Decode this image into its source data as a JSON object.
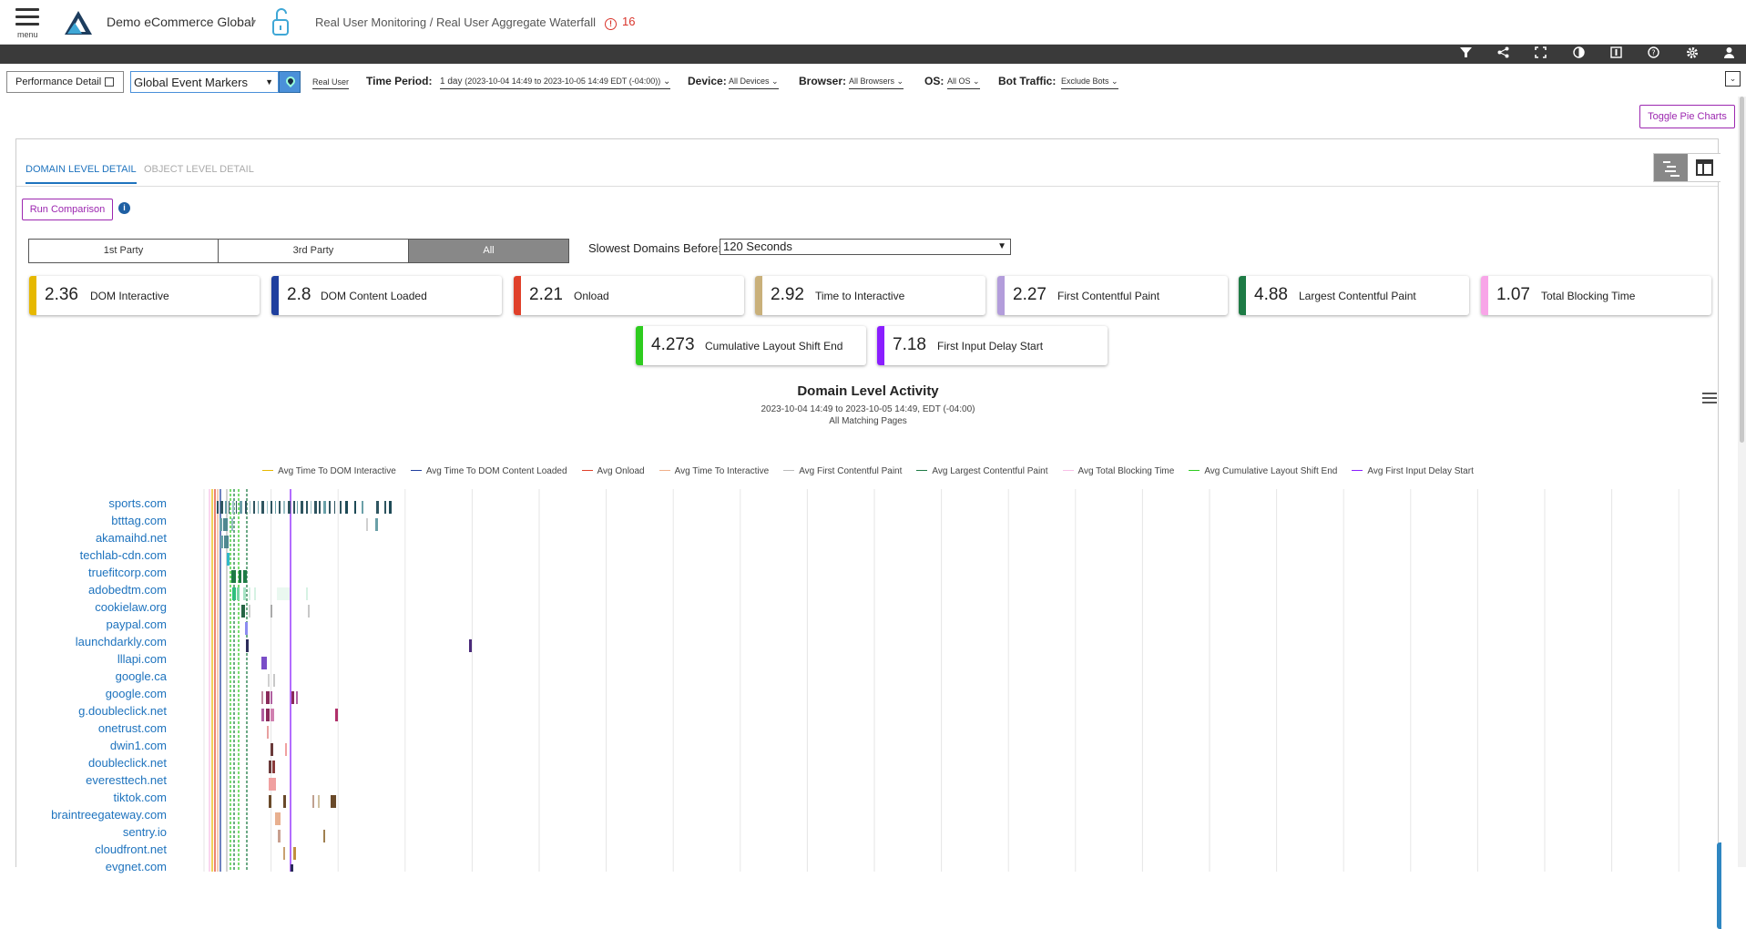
{
  "header": {
    "menu_label": "menu",
    "app_name": "Demo eCommerce Global",
    "breadcrumb": "Real User Monitoring / Real User Aggregate Waterfall",
    "alert_count": "16"
  },
  "toolbar_icons": [
    "filter-icon",
    "share-icon",
    "fullscreen-icon",
    "contrast-icon",
    "report-icon",
    "help-icon",
    "gear-icon",
    "user-icon"
  ],
  "filters": {
    "performance_detail": "Performance Detail",
    "event_markers": "Global Event Markers",
    "real_user": "Real User",
    "time_period_label": "Time Period:",
    "time_period_value": "1 day",
    "time_period_range": "(2023-10-04 14:49 to 2023-10-05 14:49 EDT (-04:00))",
    "device_label": "Device:",
    "device_value": "All Devices",
    "browser_label": "Browser:",
    "browser_value": "All Browsers",
    "os_label": "OS:",
    "os_value": "All OS",
    "bot_label": "Bot Traffic:",
    "bot_value": "Exclude Bots"
  },
  "toggle_pie": "Toggle Pie Charts",
  "tabs": [
    "DOMAIN LEVEL DETAIL",
    "OBJECT LEVEL DETAIL"
  ],
  "run_comparison": "Run Comparison",
  "party": [
    "1st Party",
    "3rd Party",
    "All"
  ],
  "slowest_label": "Slowest Domains Before:",
  "slowest_value": "120 Seconds",
  "metrics": [
    {
      "value": "2.36",
      "label": "DOM Interactive",
      "color": "#e6b800"
    },
    {
      "value": "2.8",
      "label": "DOM Content Loaded",
      "color": "#1f3f9e"
    },
    {
      "value": "2.21",
      "label": "Onload",
      "color": "#e0402a"
    },
    {
      "value": "2.92",
      "label": "Time to Interactive",
      "color": "#c9b07a"
    },
    {
      "value": "2.27",
      "label": "First Contentful Paint",
      "color": "#b39ddb"
    },
    {
      "value": "4.88",
      "label": "Largest Contentful Paint",
      "color": "#1e7b45"
    },
    {
      "value": "1.07",
      "label": "Total Blocking Time",
      "color": "#f8a5e8"
    },
    {
      "value": "4.273",
      "label": "Cumulative Layout Shift End",
      "color": "#2ecc1f"
    },
    {
      "value": "7.18",
      "label": "First Input Delay Start",
      "color": "#8a1eff"
    }
  ],
  "chart": {
    "title": "Domain Level Activity",
    "subtitle1": "2023-10-04 14:49 to 2023-10-05 14:49, EDT (-04:00)",
    "subtitle2": "All Matching Pages",
    "legend": [
      {
        "name": "Avg Time To DOM Interactive",
        "color": "#e6b800"
      },
      {
        "name": "Avg Time To DOM Content Loaded",
        "color": "#1f3f9e"
      },
      {
        "name": "Avg Onload",
        "color": "#e0402a"
      },
      {
        "name": "Avg Time To Interactive",
        "color": "#f0b08a"
      },
      {
        "name": "Avg First Contentful Paint",
        "color": "#bbbbbb"
      },
      {
        "name": "Avg Largest Contentful Paint",
        "color": "#1e7b45"
      },
      {
        "name": "Avg Total Blocking Time",
        "color": "#f8c0e8"
      },
      {
        "name": "Avg Cumulative Layout Shift End",
        "color": "#2ecc1f"
      },
      {
        "name": "Avg First Input Delay Start",
        "color": "#8a1eff"
      }
    ],
    "domains": [
      "sports.com",
      "btttag.com",
      "akamaihd.net",
      "techlab-cdn.com",
      "truefitcorp.com",
      "adobedtm.com",
      "cookielaw.org",
      "paypal.com",
      "launchdarkly.com",
      "lllapi.com",
      "google.ca",
      "google.com",
      "g.doubleclick.net",
      "onetrust.com",
      "dwin1.com",
      "doubleclick.net",
      "everesttech.net",
      "tiktok.com",
      "braintreegateway.com",
      "sentry.io",
      "cloudfront.net",
      "evgnet.com"
    ]
  }
}
